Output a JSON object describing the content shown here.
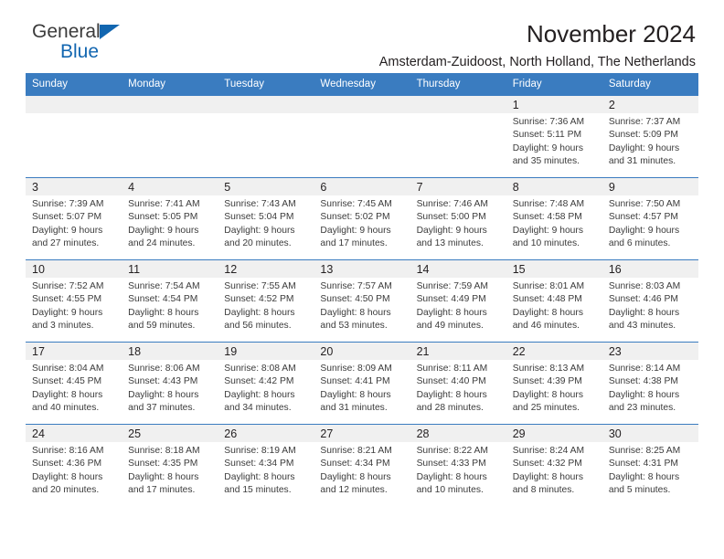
{
  "brand": {
    "name_part1": "General",
    "name_part2": "Blue",
    "triangle_color": "#1266b0"
  },
  "header": {
    "title": "November 2024",
    "subtitle": "Amsterdam-Zuidoost, North Holland, The Netherlands"
  },
  "theme": {
    "header_blue": "#3a7cc0",
    "daynum_band": "#f0f0f0",
    "text": "#231f20",
    "body_text": "#3b3b3b"
  },
  "weekdays": [
    "Sunday",
    "Monday",
    "Tuesday",
    "Wednesday",
    "Thursday",
    "Friday",
    "Saturday"
  ],
  "labels": {
    "sunrise_prefix": "Sunrise: ",
    "sunset_prefix": "Sunset: ",
    "daylight_prefix": "Daylight: "
  },
  "weeks": [
    [
      {
        "empty": true
      },
      {
        "empty": true
      },
      {
        "empty": true
      },
      {
        "empty": true
      },
      {
        "empty": true
      },
      {
        "day": "1",
        "sunrise": "Sunrise: 7:36 AM",
        "sunset": "Sunset: 5:11 PM",
        "daylight": "Daylight: 9 hours and 35 minutes."
      },
      {
        "day": "2",
        "sunrise": "Sunrise: 7:37 AM",
        "sunset": "Sunset: 5:09 PM",
        "daylight": "Daylight: 9 hours and 31 minutes."
      }
    ],
    [
      {
        "day": "3",
        "sunrise": "Sunrise: 7:39 AM",
        "sunset": "Sunset: 5:07 PM",
        "daylight": "Daylight: 9 hours and 27 minutes."
      },
      {
        "day": "4",
        "sunrise": "Sunrise: 7:41 AM",
        "sunset": "Sunset: 5:05 PM",
        "daylight": "Daylight: 9 hours and 24 minutes."
      },
      {
        "day": "5",
        "sunrise": "Sunrise: 7:43 AM",
        "sunset": "Sunset: 5:04 PM",
        "daylight": "Daylight: 9 hours and 20 minutes."
      },
      {
        "day": "6",
        "sunrise": "Sunrise: 7:45 AM",
        "sunset": "Sunset: 5:02 PM",
        "daylight": "Daylight: 9 hours and 17 minutes."
      },
      {
        "day": "7",
        "sunrise": "Sunrise: 7:46 AM",
        "sunset": "Sunset: 5:00 PM",
        "daylight": "Daylight: 9 hours and 13 minutes."
      },
      {
        "day": "8",
        "sunrise": "Sunrise: 7:48 AM",
        "sunset": "Sunset: 4:58 PM",
        "daylight": "Daylight: 9 hours and 10 minutes."
      },
      {
        "day": "9",
        "sunrise": "Sunrise: 7:50 AM",
        "sunset": "Sunset: 4:57 PM",
        "daylight": "Daylight: 9 hours and 6 minutes."
      }
    ],
    [
      {
        "day": "10",
        "sunrise": "Sunrise: 7:52 AM",
        "sunset": "Sunset: 4:55 PM",
        "daylight": "Daylight: 9 hours and 3 minutes."
      },
      {
        "day": "11",
        "sunrise": "Sunrise: 7:54 AM",
        "sunset": "Sunset: 4:54 PM",
        "daylight": "Daylight: 8 hours and 59 minutes."
      },
      {
        "day": "12",
        "sunrise": "Sunrise: 7:55 AM",
        "sunset": "Sunset: 4:52 PM",
        "daylight": "Daylight: 8 hours and 56 minutes."
      },
      {
        "day": "13",
        "sunrise": "Sunrise: 7:57 AM",
        "sunset": "Sunset: 4:50 PM",
        "daylight": "Daylight: 8 hours and 53 minutes."
      },
      {
        "day": "14",
        "sunrise": "Sunrise: 7:59 AM",
        "sunset": "Sunset: 4:49 PM",
        "daylight": "Daylight: 8 hours and 49 minutes."
      },
      {
        "day": "15",
        "sunrise": "Sunrise: 8:01 AM",
        "sunset": "Sunset: 4:48 PM",
        "daylight": "Daylight: 8 hours and 46 minutes."
      },
      {
        "day": "16",
        "sunrise": "Sunrise: 8:03 AM",
        "sunset": "Sunset: 4:46 PM",
        "daylight": "Daylight: 8 hours and 43 minutes."
      }
    ],
    [
      {
        "day": "17",
        "sunrise": "Sunrise: 8:04 AM",
        "sunset": "Sunset: 4:45 PM",
        "daylight": "Daylight: 8 hours and 40 minutes."
      },
      {
        "day": "18",
        "sunrise": "Sunrise: 8:06 AM",
        "sunset": "Sunset: 4:43 PM",
        "daylight": "Daylight: 8 hours and 37 minutes."
      },
      {
        "day": "19",
        "sunrise": "Sunrise: 8:08 AM",
        "sunset": "Sunset: 4:42 PM",
        "daylight": "Daylight: 8 hours and 34 minutes."
      },
      {
        "day": "20",
        "sunrise": "Sunrise: 8:09 AM",
        "sunset": "Sunset: 4:41 PM",
        "daylight": "Daylight: 8 hours and 31 minutes."
      },
      {
        "day": "21",
        "sunrise": "Sunrise: 8:11 AM",
        "sunset": "Sunset: 4:40 PM",
        "daylight": "Daylight: 8 hours and 28 minutes."
      },
      {
        "day": "22",
        "sunrise": "Sunrise: 8:13 AM",
        "sunset": "Sunset: 4:39 PM",
        "daylight": "Daylight: 8 hours and 25 minutes."
      },
      {
        "day": "23",
        "sunrise": "Sunrise: 8:14 AM",
        "sunset": "Sunset: 4:38 PM",
        "daylight": "Daylight: 8 hours and 23 minutes."
      }
    ],
    [
      {
        "day": "24",
        "sunrise": "Sunrise: 8:16 AM",
        "sunset": "Sunset: 4:36 PM",
        "daylight": "Daylight: 8 hours and 20 minutes."
      },
      {
        "day": "25",
        "sunrise": "Sunrise: 8:18 AM",
        "sunset": "Sunset: 4:35 PM",
        "daylight": "Daylight: 8 hours and 17 minutes."
      },
      {
        "day": "26",
        "sunrise": "Sunrise: 8:19 AM",
        "sunset": "Sunset: 4:34 PM",
        "daylight": "Daylight: 8 hours and 15 minutes."
      },
      {
        "day": "27",
        "sunrise": "Sunrise: 8:21 AM",
        "sunset": "Sunset: 4:34 PM",
        "daylight": "Daylight: 8 hours and 12 minutes."
      },
      {
        "day": "28",
        "sunrise": "Sunrise: 8:22 AM",
        "sunset": "Sunset: 4:33 PM",
        "daylight": "Daylight: 8 hours and 10 minutes."
      },
      {
        "day": "29",
        "sunrise": "Sunrise: 8:24 AM",
        "sunset": "Sunset: 4:32 PM",
        "daylight": "Daylight: 8 hours and 8 minutes."
      },
      {
        "day": "30",
        "sunrise": "Sunrise: 8:25 AM",
        "sunset": "Sunset: 4:31 PM",
        "daylight": "Daylight: 8 hours and 5 minutes."
      }
    ]
  ]
}
